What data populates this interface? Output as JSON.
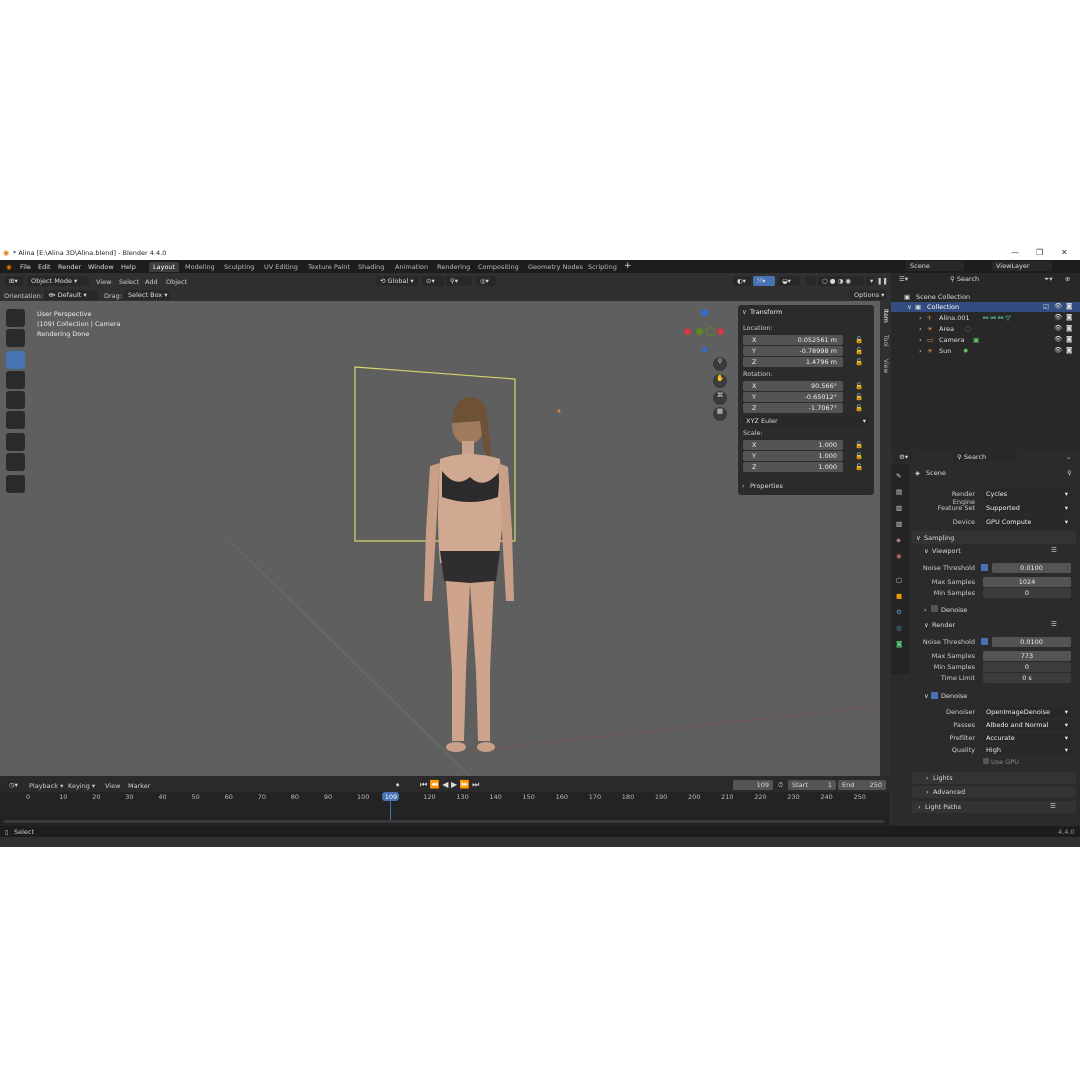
{
  "window": {
    "title": "* Alina [E:\\Alina 3D\\Alina.blend] - Blender 4.4.0"
  },
  "menu": [
    "File",
    "Edit",
    "Render",
    "Window",
    "Help"
  ],
  "workspaces": [
    "Layout",
    "Modeling",
    "Sculpting",
    "UV Editing",
    "Texture Paint",
    "Shading",
    "Animation",
    "Rendering",
    "Compositing",
    "Geometry Nodes",
    "Scripting"
  ],
  "header": {
    "mode": "Object Mode",
    "view": "View",
    "select": "Select",
    "add": "Add",
    "object": "Object",
    "transform": "Global",
    "orientation_label": "Orientation:",
    "orientation": "Default",
    "drag_label": "Drag:",
    "drag": "Select Box",
    "options": "Options"
  },
  "viewport": {
    "line1": "User Perspective",
    "line2": "(109) Collection | Camera",
    "line3": "Rendering Done"
  },
  "npanel": {
    "title": "Transform",
    "location_label": "Location:",
    "rotation_label": "Rotation:",
    "scale_label": "Scale:",
    "location": [
      {
        "k": "X",
        "v": "0.052561 m"
      },
      {
        "k": "Y",
        "v": "-0.78998 m"
      },
      {
        "k": "Z",
        "v": "1.4796 m"
      }
    ],
    "rotation": [
      {
        "k": "X",
        "v": "90.566°"
      },
      {
        "k": "Y",
        "v": "-0.65012°"
      },
      {
        "k": "Z",
        "v": "-1.7067°"
      }
    ],
    "rotation_mode": "XYZ Euler",
    "scale": [
      {
        "k": "X",
        "v": "1.000"
      },
      {
        "k": "Y",
        "v": "1.000"
      },
      {
        "k": "Z",
        "v": "1.000"
      }
    ],
    "properties": "Properties",
    "tabs": [
      "Item",
      "Tool",
      "View"
    ]
  },
  "outliner": {
    "scene": "Scene",
    "viewlayer": "ViewLayer",
    "search": "Search",
    "root": "Scene Collection",
    "collection": "Collection",
    "items": [
      "Alina.001",
      "Area",
      "Camera",
      "Sun"
    ]
  },
  "properties": {
    "search": "Search",
    "context": "Scene",
    "render_engine_label": "Render Engine",
    "render_engine": "Cycles",
    "feature_set_label": "Feature Set",
    "feature_set": "Supported",
    "device_label": "Device",
    "device": "GPU Compute",
    "sampling": "Sampling",
    "viewport": "Viewport",
    "vp_noise_label": "Noise Threshold",
    "vp_noise": "0.0100",
    "vp_max_label": "Max Samples",
    "vp_max": "1024",
    "vp_min_label": "Min Samples",
    "vp_min": "0",
    "vp_denoise": "Denoise",
    "render": "Render",
    "r_noise_label": "Noise Threshold",
    "r_noise": "0.0100",
    "r_max_label": "Max Samples",
    "r_max": "773",
    "r_min_label": "Min Samples",
    "r_min": "0",
    "r_time_label": "Time Limit",
    "r_time": "0 s",
    "denoise": "Denoise",
    "denoiser_label": "Denoiser",
    "denoiser": "OpenImageDenoise",
    "passes_label": "Passes",
    "passes": "Albedo and Normal",
    "prefilter_label": "Prefilter",
    "prefilter": "Accurate",
    "quality_label": "Quality",
    "quality": "High",
    "use_gpu": "Use GPU",
    "lights": "Lights",
    "advanced": "Advanced",
    "light_paths": "Light Paths"
  },
  "timeline": {
    "playback": "Playback",
    "keying": "Keying",
    "view": "View",
    "marker": "Marker",
    "current": "109",
    "start_label": "Start",
    "start": "1",
    "end_label": "End",
    "end": "250",
    "ticks": [
      "0",
      "10",
      "20",
      "30",
      "40",
      "50",
      "60",
      "70",
      "80",
      "90",
      "100",
      "109",
      "120",
      "130",
      "140",
      "150",
      "160",
      "170",
      "180",
      "190",
      "200",
      "210",
      "220",
      "230",
      "240",
      "250"
    ]
  },
  "status": {
    "left": "Select",
    "version": "4.4.0"
  },
  "colors": {
    "accent": "#4772b3",
    "camera_frame": "#d6d66a",
    "background": "#303030"
  }
}
